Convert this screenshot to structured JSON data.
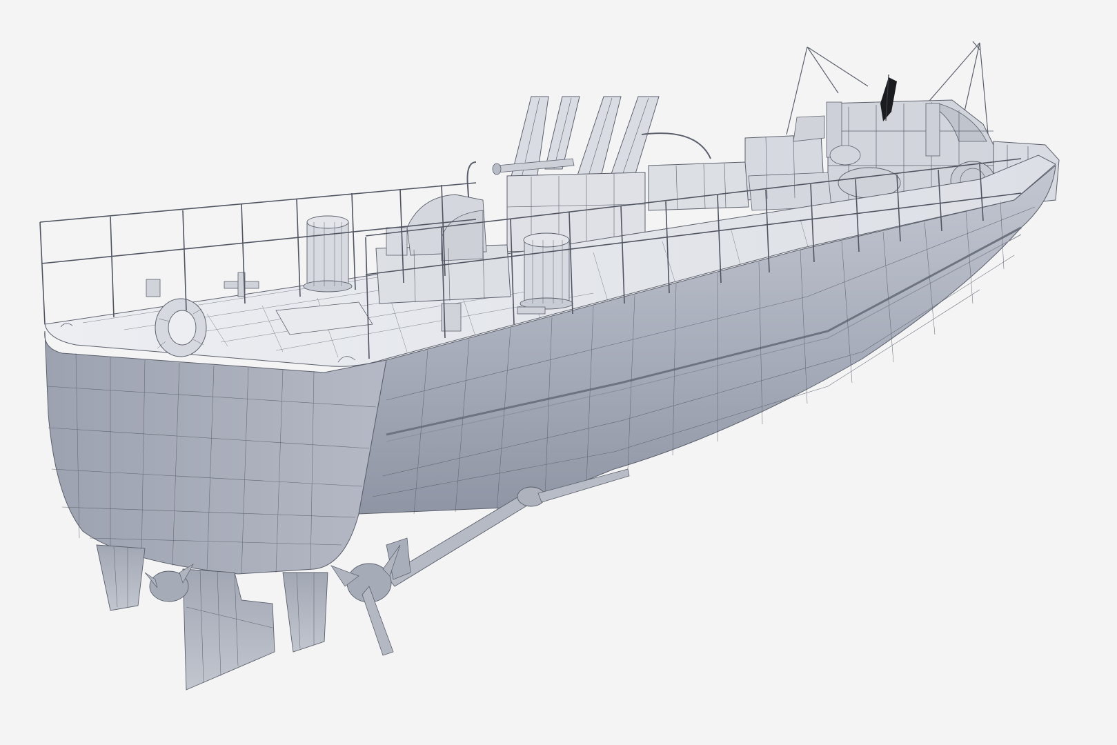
{
  "scene": {
    "background_color": "#f4f4f5",
    "hull_color_light": "#c9cdd6",
    "hull_color_mid": "#a9aebb",
    "hull_color_dark": "#8e94a3",
    "deck_color": "#e3e5ea",
    "wire_color": "#5a5f6b",
    "flag_color": "#1a1c20"
  }
}
